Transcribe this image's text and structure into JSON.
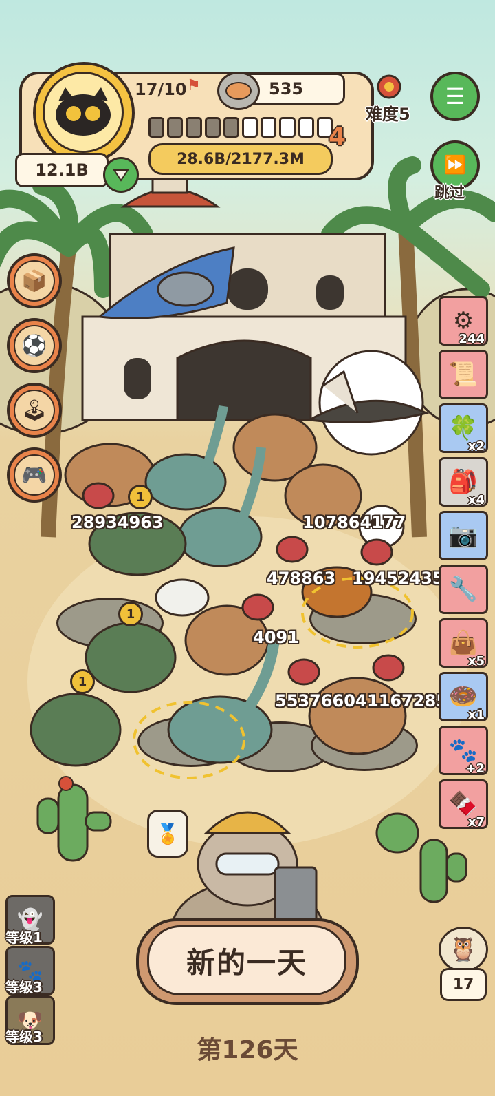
{
  "hud": {
    "stage_progress": "17/10",
    "coins": "535",
    "difficulty": "难度5",
    "power": "12.1B",
    "xp": "28.6B/2177.3M",
    "level": "4",
    "segments_filled": 5,
    "segments_total": 10
  },
  "skip_label": "跳过",
  "side_items": [
    {
      "count": "244"
    },
    {
      "count": ""
    },
    {
      "count": "x2"
    },
    {
      "count": "x4"
    },
    {
      "count": ""
    },
    {
      "count": ""
    },
    {
      "count": "x5"
    },
    {
      "count": "x1"
    },
    {
      "count": "+2"
    },
    {
      "count": "x7"
    }
  ],
  "arena_numbers": [
    "28934963",
    "107864177",
    "478863",
    "19452435",
    "4091",
    "55376604",
    "1167285"
  ],
  "level_badges": [
    "1",
    "1",
    "1"
  ],
  "levels": [
    "等级1",
    "等级3",
    "等级3"
  ],
  "new_day_label": "新的一天",
  "day_label": "第126天",
  "helper_count": "17",
  "icons": [
    "cat-avatar-icon",
    "flag-icon",
    "food-can-icon",
    "flower-icon",
    "menu-icon",
    "fast-forward-icon",
    "heart-down-icon",
    "box-icon",
    "ball-icon",
    "joystick-icon",
    "gameboy-icon",
    "certificate-icon",
    "owl-icon"
  ]
}
